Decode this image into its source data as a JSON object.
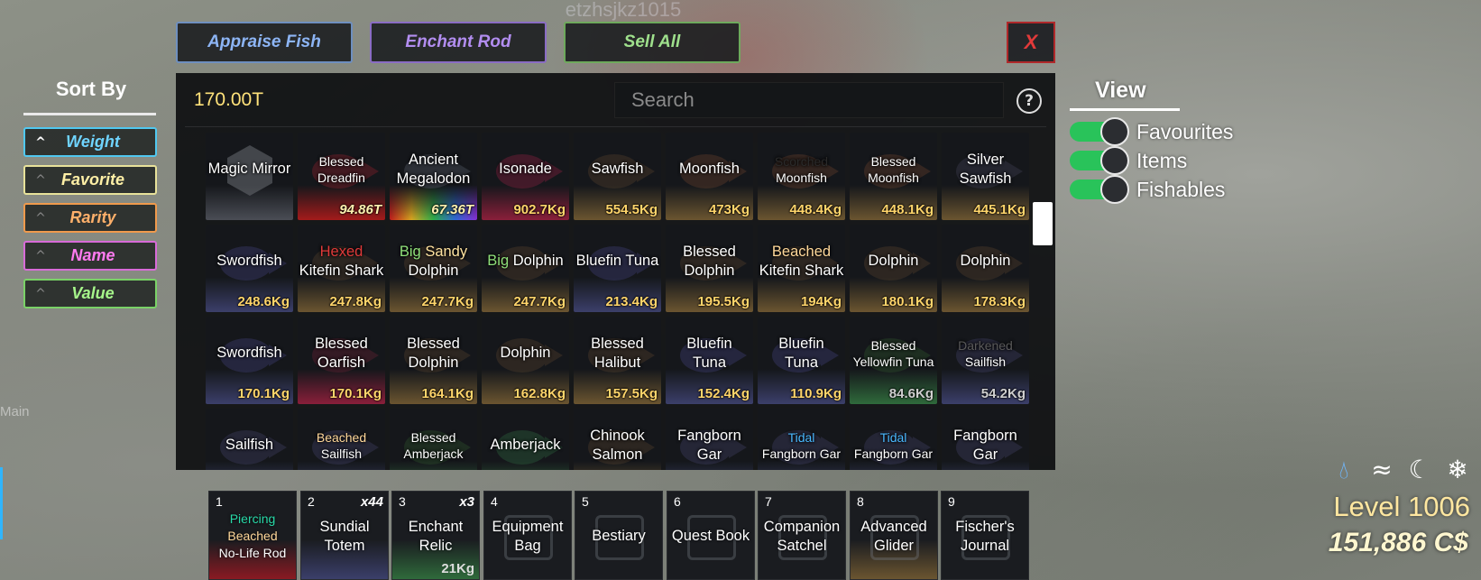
{
  "player": {
    "username": "etzhsjkz1015"
  },
  "top_buttons": [
    {
      "label": "Appraise Fish",
      "color": "#8db5f5",
      "border": "#6e8fbf"
    },
    {
      "label": "Enchant Rod",
      "color": "#b28df0",
      "border": "#8a6cc4"
    },
    {
      "label": "Sell All",
      "color": "#9fe08c",
      "border": "#6ea95c"
    }
  ],
  "close_button": {
    "label": "X"
  },
  "sort": {
    "title": "Sort By",
    "options": [
      {
        "label": "Weight",
        "color": "#6fd4ff",
        "border": "#50c8f0",
        "chevron": "^",
        "active": true
      },
      {
        "label": "Favorite",
        "color": "#fff0a6",
        "border": "#e8e29a",
        "chevron": "^"
      },
      {
        "label": "Rarity",
        "color": "#ffb06a",
        "border": "#f09a4c",
        "chevron": "^"
      },
      {
        "label": "Name",
        "color": "#ff7bf0",
        "border": "#d86bd8",
        "chevron": "^"
      },
      {
        "label": "Value",
        "color": "#a6f58a",
        "border": "#7ad267",
        "chevron": "^"
      }
    ]
  },
  "inventory": {
    "currency": "170.00T",
    "search_placeholder": "Search",
    "help": "?",
    "items": [
      {
        "name": "Magic Mirror",
        "weight": "",
        "icon": "hex",
        "tint": "#4a4d55"
      },
      {
        "mutation": "Blessed",
        "mutation_color": "#ffffff",
        "name": "Dreadfin",
        "weight": "94.86T",
        "weight_style": "ital",
        "small": true,
        "tint": "#a31b1b",
        "fish": "#7a1f2a"
      },
      {
        "mutation": "Ancient",
        "mutation_color": "#ffffff",
        "name": "Megalodon",
        "weight": "67.36T",
        "weight_style": "ital",
        "tint": "#3a52c8",
        "fish": "#4a4f5a",
        "rainbow": true
      },
      {
        "name": "Isonade",
        "weight": "902.7Kg",
        "tint": "#8a1f3a",
        "fish": "#7a1f3a"
      },
      {
        "name": "Sawfish",
        "weight": "554.5Kg",
        "tint": "#6b5530",
        "fish": "#4a3a2a"
      },
      {
        "name": "Moonfish",
        "weight": "473Kg",
        "tint": "#6b5530",
        "fish": "#5a3a2a"
      },
      {
        "mutation": "Scorched",
        "mutation_color": "#2a2a2a",
        "name": "Moonfish",
        "weight": "448.4Kg",
        "small": true,
        "tint": "#6b5530",
        "fish": "#5a3a2a"
      },
      {
        "mutation": "Blessed",
        "mutation_color": "#ffffff",
        "name": "Moonfish",
        "weight": "448.1Kg",
        "small": true,
        "tint": "#6b5530",
        "fish": "#5a3a2a"
      },
      {
        "mutation": "Silver",
        "mutation_color": "#ffffff",
        "name": "Sawfish",
        "weight": "445.1Kg",
        "tint": "#6b5530",
        "fish": "#3a3a4a"
      },
      {
        "name": "Swordfish",
        "weight": "248.6Kg",
        "tint": "#3b3f6a",
        "fish": "#3a3a6a"
      },
      {
        "mutation": "Hexed",
        "mutation_color": "#e03a3a",
        "name": "Kitefin Shark",
        "weight": "247.8Kg",
        "tint": "#6b5530",
        "fish": "#4a3a2a"
      },
      {
        "mutation": "Big Sandy",
        "mutation_color": "#8fe07a",
        "mutation2": "Sandy",
        "mutation2_color": "#ffe3a0",
        "name": "Dolphin",
        "weight": "247.7Kg",
        "tint": "#6b5530",
        "fish": "#4a3a2a"
      },
      {
        "inline_prefix": "Big",
        "inline_prefix_color": "#8fe07a",
        "name": "Dolphin",
        "weight": "247.7Kg",
        "tint": "#6b5530",
        "fish": "#4a3a2a"
      },
      {
        "name": "Bluefin Tuna",
        "weight": "213.4Kg",
        "tint": "#3b3f6a",
        "fish": "#3a3a6a"
      },
      {
        "mutation": "Blessed",
        "mutation_color": "#ffffff",
        "name": "Dolphin",
        "weight": "195.5Kg",
        "tint": "#6b5530",
        "fish": "#4a3a2a"
      },
      {
        "mutation": "Beached",
        "mutation_color": "#ffd89a",
        "name": "Kitefin Shark",
        "weight": "194Kg",
        "tint": "#6b5530",
        "fish": "#4a3a2a"
      },
      {
        "name": "Dolphin",
        "weight": "180.1Kg",
        "tint": "#6b5530",
        "fish": "#4a3a2a"
      },
      {
        "name": "Dolphin",
        "weight": "178.3Kg",
        "tint": "#6b5530",
        "fish": "#4a3a2a"
      },
      {
        "name": "Swordfish",
        "weight": "170.1Kg",
        "tint": "#3b3f6a",
        "fish": "#3a3a6a"
      },
      {
        "mutation": "Blessed",
        "mutation_color": "#ffffff",
        "name": "Oarfish",
        "weight": "170.1Kg",
        "tint": "#8a1f3a",
        "fish": "#5a2030"
      },
      {
        "mutation": "Blessed",
        "mutation_color": "#ffffff",
        "name": "Dolphin",
        "weight": "164.1Kg",
        "tint": "#6b5530",
        "fish": "#4a3a2a"
      },
      {
        "name": "Dolphin",
        "weight": "162.8Kg",
        "tint": "#6b5530",
        "fish": "#4a3a2a"
      },
      {
        "mutation": "Blessed",
        "mutation_color": "#ffffff",
        "name": "Halibut",
        "weight": "157.5Kg",
        "tint": "#6b5530",
        "fish": "#4a3a2a"
      },
      {
        "mutation": "Bluefin",
        "mutation_color": "#ffffff",
        "name": "Tuna",
        "weight": "152.4Kg",
        "tint": "#3b3f6a",
        "fish": "#3a3a6a"
      },
      {
        "mutation": "Bluefin",
        "mutation_color": "#ffffff",
        "name": "Tuna",
        "weight": "110.9Kg",
        "tint": "#3b3f6a",
        "fish": "#3a3a6a"
      },
      {
        "mutation": "Blessed",
        "mutation_color": "#ffffff",
        "name": "Yellowfin Tuna",
        "weight": "84.6Kg",
        "weight_style": "grey",
        "small": true,
        "tint": "#2f6a3b",
        "fish": "#2a4a2a"
      },
      {
        "mutation": "Darkened",
        "mutation_color": "#5a5a5a",
        "name": "Sailfish",
        "weight": "54.2Kg",
        "weight_style": "grey",
        "small": true,
        "tint": "#3b3f6a",
        "fish": "#3a3a5a"
      },
      {
        "name": "Sailfish",
        "weight": "",
        "tint": "#3b3f6a",
        "fish": "#3a3a5a"
      },
      {
        "mutation": "Beached",
        "mutation_color": "#ffd89a",
        "name": "Sailfish",
        "weight": "",
        "small": true,
        "tint": "#3b3f6a",
        "fish": "#3a3a5a"
      },
      {
        "mutation": "Blessed",
        "mutation_color": "#ffffff",
        "name": "Amberjack",
        "weight": "",
        "small": true,
        "tint": "#2f6a3b",
        "fish": "#2a4a2a"
      },
      {
        "name": "Amberjack",
        "weight": "",
        "tint": "#2f6a3b",
        "fish": "#2a5a3a"
      },
      {
        "mutation": "Chinook",
        "mutation_color": "#ffffff",
        "name": "Salmon",
        "weight": "",
        "tint": "#6b5530",
        "fish": "#4a3a2a"
      },
      {
        "mutation": "Fangborn",
        "mutation_color": "#ffffff",
        "name": "Gar",
        "weight": "",
        "tint": "#3b3f6a",
        "fish": "#3a3a5a"
      },
      {
        "mutation": "Tidal",
        "mutation_color": "#4ab8ff",
        "name": "Fangborn Gar",
        "weight": "",
        "small": true,
        "tint": "#3b3f6a",
        "fish": "#3a3a5a"
      },
      {
        "mutation": "Tidal",
        "mutation_color": "#4ab8ff",
        "name": "Fangborn Gar",
        "weight": "",
        "small": true,
        "tint": "#3b3f6a",
        "fish": "#3a3a5a"
      },
      {
        "mutation": "Fangborn",
        "mutation_color": "#ffffff",
        "name": "Gar",
        "weight": "",
        "tint": "#3b3f6a",
        "fish": "#3a3a5a"
      }
    ]
  },
  "view": {
    "title": "View",
    "toggles": [
      {
        "label": "Favourites",
        "on": true
      },
      {
        "label": "Items",
        "on": true
      },
      {
        "label": "Fishables",
        "on": true
      }
    ]
  },
  "hotbar": [
    {
      "num": "1",
      "lines": [
        {
          "text": "Piercing",
          "color": "#28d9a8"
        },
        {
          "text": "Beached",
          "color": "#ffd89a"
        },
        {
          "text": "No-Life Rod",
          "color": "#ffffff"
        }
      ],
      "small": true,
      "tint": "#8a1a22"
    },
    {
      "num": "2",
      "qty": "x44",
      "lines": [
        {
          "text": "Sundial",
          "color": "#ffffff"
        },
        {
          "text": "Totem",
          "color": "#ffffff"
        }
      ],
      "tint": "#3b3f6a"
    },
    {
      "num": "3",
      "qty": "x3",
      "sub": "21Kg",
      "lines": [
        {
          "text": "Enchant",
          "color": "#ffffff"
        },
        {
          "text": "Relic",
          "color": "#ffffff"
        }
      ],
      "tint": "#2f6a3b"
    },
    {
      "num": "4",
      "lines": [
        {
          "text": "Equipment",
          "color": "#ffffff"
        },
        {
          "text": "Bag",
          "color": "#ffffff"
        }
      ],
      "tint": "#1a1c20"
    },
    {
      "num": "5",
      "lines": [
        {
          "text": "Bestiary",
          "color": "#ffffff"
        }
      ],
      "tint": "#1a1c20"
    },
    {
      "num": "6",
      "lines": [
        {
          "text": "Quest Book",
          "color": "#ffffff"
        }
      ],
      "tint": "#1a1c20"
    },
    {
      "num": "7",
      "lines": [
        {
          "text": "Companion",
          "color": "#ffffff"
        },
        {
          "text": "Satchel",
          "color": "#ffffff"
        }
      ],
      "tint": "#1a1c20"
    },
    {
      "num": "8",
      "lines": [
        {
          "text": "Advanced",
          "color": "#ffffff"
        },
        {
          "text": "Glider",
          "color": "#ffffff"
        }
      ],
      "tint": "#6b5530"
    },
    {
      "num": "9",
      "lines": [
        {
          "text": "Fischer's",
          "color": "#ffffff"
        },
        {
          "text": "Journal",
          "color": "#ffffff"
        }
      ],
      "tint": "#1a1c20"
    }
  ],
  "status": {
    "icons": [
      "water-drop-icon",
      "wind-icon",
      "moon-icon",
      "snowflake-icon"
    ],
    "level": "Level 1006",
    "money": "151,886 C$"
  },
  "background_label": "Main"
}
